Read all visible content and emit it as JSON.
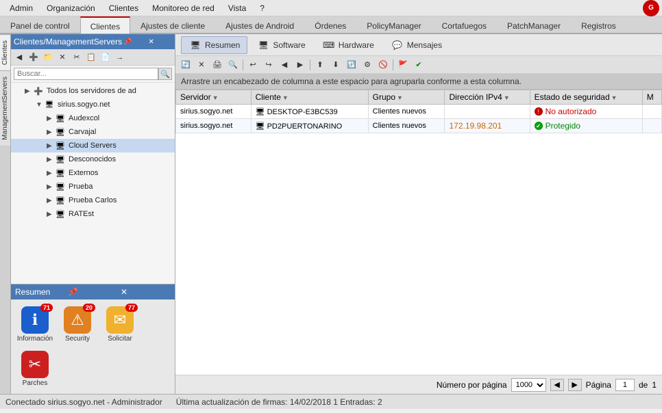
{
  "menubar": {
    "items": [
      "Admin",
      "Organización",
      "Clientes",
      "Monitoreo de red",
      "Vista",
      "?"
    ]
  },
  "main_tabs": {
    "tabs": [
      "Panel de control",
      "Clientes",
      "Ajustes de cliente",
      "Ajustes de Android",
      "Órdenes",
      "PolicyManager",
      "Cortafuegos",
      "PatchManager",
      "Registros"
    ],
    "active": "Clientes"
  },
  "left_panel": {
    "title": "Clientes/ManagementServers",
    "search_placeholder": "Buscar...",
    "tree": {
      "root": "Todos los servidores de ad",
      "server": "sirius.sogyo.net",
      "items": [
        "Audexcol",
        "Carvajal",
        "Cloud Servers",
        "Desconocidos",
        "Externos",
        "Prueba",
        "Prueba Carlos",
        "RATEst"
      ]
    }
  },
  "side_tabs": [
    "Clientes",
    "ManagementServers"
  ],
  "sec_tabs": {
    "items": [
      "Resumen",
      "Software",
      "Hardware",
      "Mensajes"
    ],
    "active": "Resumen"
  },
  "group_header": "Arrastre un encabezado de columna a este espacio para agruparla conforme a esta columna.",
  "table": {
    "columns": [
      "Servidor",
      "Cliente",
      "Grupo",
      "Dirección IPv4",
      "Estado de seguridad",
      "M"
    ],
    "rows": [
      {
        "servidor": "sirius.sogyo.net",
        "cliente": "DESKTOP-E3BC539",
        "grupo": "Clientes nuevos",
        "ip": "",
        "estado": "No autorizado",
        "estado_type": "no_auth"
      },
      {
        "servidor": "sirius.sogyo.net",
        "cliente": "PD2PUERTONARINO",
        "grupo": "Clientes nuevos",
        "ip": "172.19.98.201",
        "estado": "Protegido",
        "estado_type": "protected"
      }
    ]
  },
  "pagination": {
    "label_items": "Número por página",
    "page_sizes": [
      "1000"
    ],
    "current_page": "1",
    "total_pages": "1",
    "label_page": "Página",
    "label_of": "de"
  },
  "statusbar": {
    "connection": "Conectado sirius.sogyo.net - Administrador",
    "update": "Última actualización de firmas: 14/02/2018 1  Entradas: 2"
  },
  "resumen": {
    "title": "Resumen",
    "items": [
      {
        "label": "Información",
        "badge": "71",
        "color": "blue",
        "icon": "ℹ"
      },
      {
        "label": "Security",
        "badge": "20",
        "color": "orange",
        "icon": "⚠"
      },
      {
        "label": "Solicitar",
        "badge": "77",
        "color": "yellow",
        "icon": "✉"
      },
      {
        "label": "Parches",
        "badge": "",
        "color": "red-tools",
        "icon": "✂"
      }
    ]
  }
}
